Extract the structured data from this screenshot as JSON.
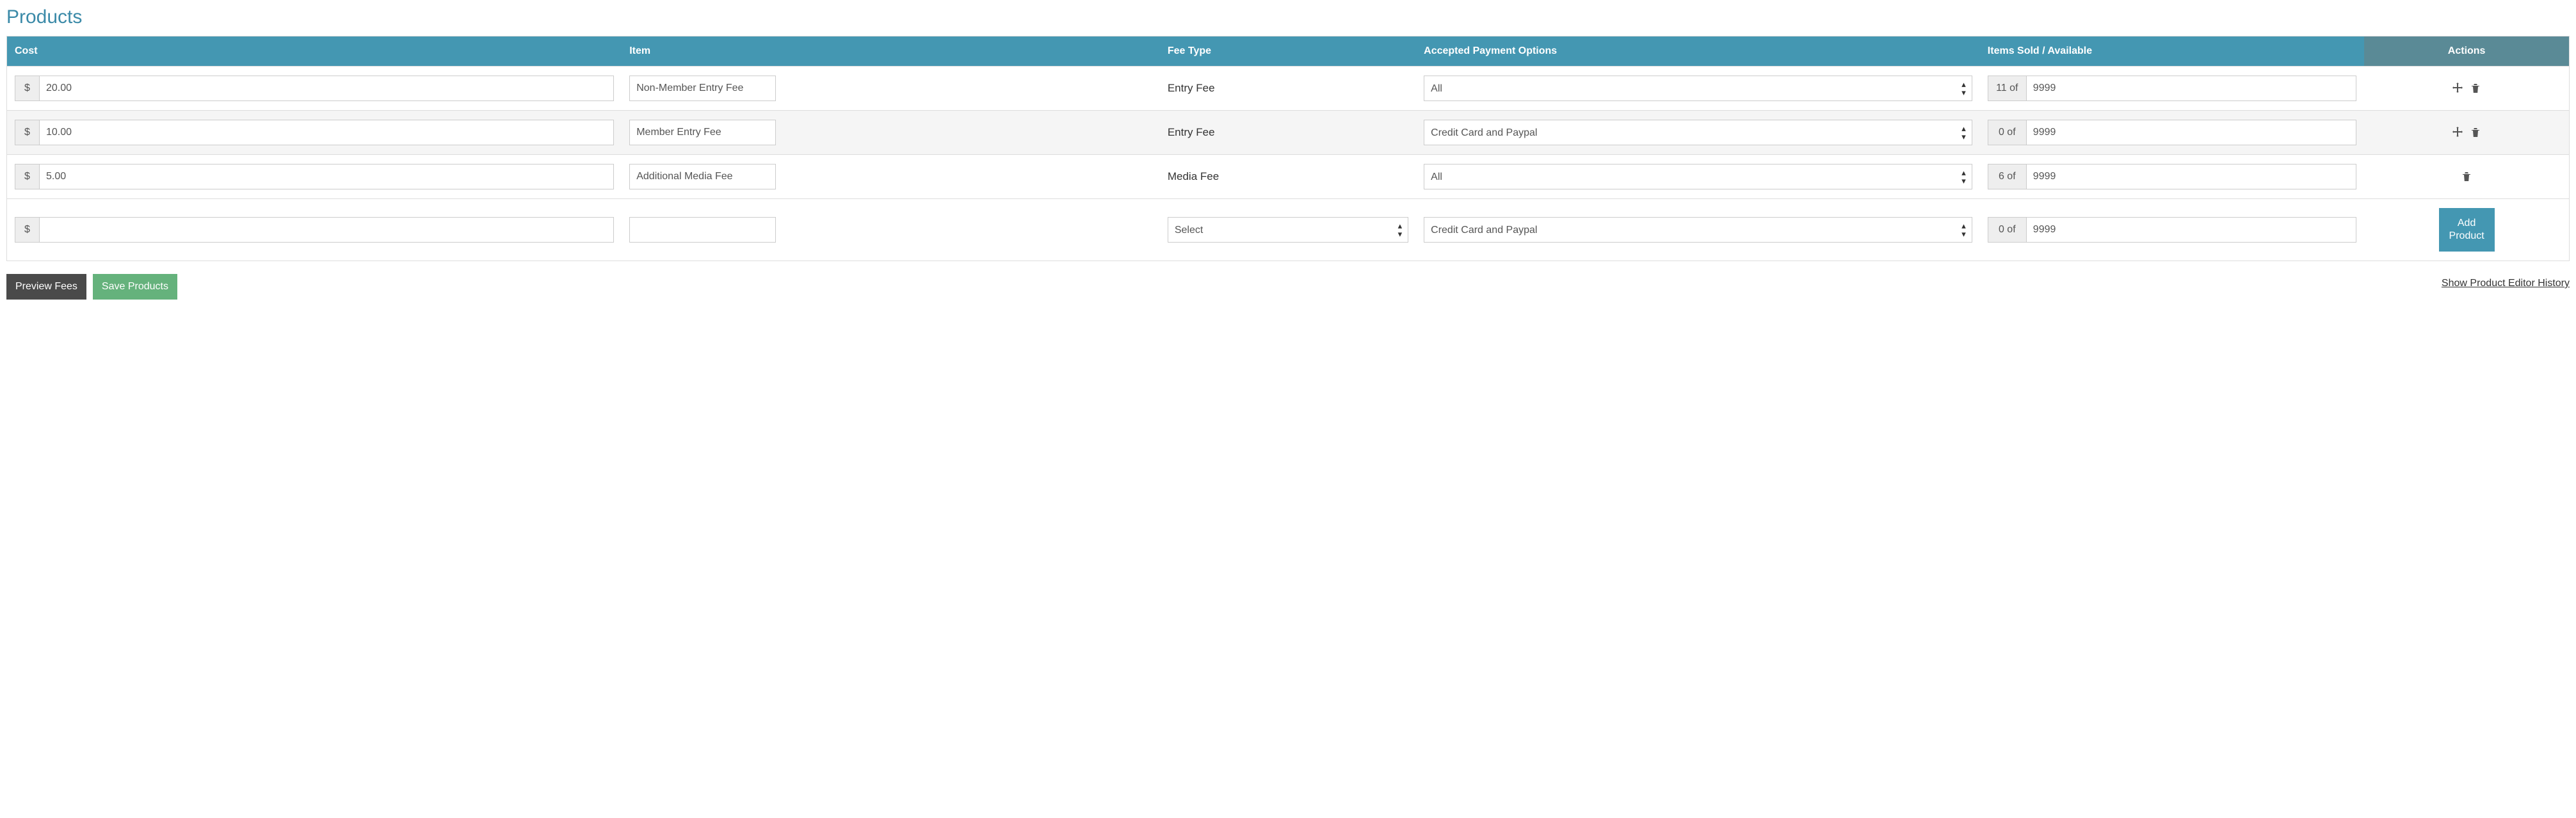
{
  "title": "Products",
  "columns": {
    "cost": "Cost",
    "item": "Item",
    "feetype": "Fee Type",
    "payment": "Accepted Payment Options",
    "sold": "Items Sold / Available",
    "actions": "Actions"
  },
  "currency_symbol": "$",
  "of_word": "of",
  "payment_options": [
    "All",
    "Credit Card and Paypal"
  ],
  "feetype_options": [
    "Select",
    "Entry Fee",
    "Media Fee"
  ],
  "rows": [
    {
      "cost": "20.00",
      "item": "Non-Member Entry Fee",
      "feetype_text": "Entry Fee",
      "feetype_is_select": false,
      "payment": "All",
      "sold": "11",
      "available": "9999",
      "show_move": true,
      "show_delete": true,
      "show_add": false,
      "alt": false
    },
    {
      "cost": "10.00",
      "item": "Member Entry Fee",
      "feetype_text": "Entry Fee",
      "feetype_is_select": false,
      "payment": "Credit Card and Paypal",
      "sold": "0",
      "available": "9999",
      "show_move": true,
      "show_delete": true,
      "show_add": false,
      "alt": true
    },
    {
      "cost": "5.00",
      "item": "Additional Media Fee",
      "feetype_text": "Media Fee",
      "feetype_is_select": false,
      "payment": "All",
      "sold": "6",
      "available": "9999",
      "show_move": false,
      "show_delete": true,
      "show_add": false,
      "alt": false
    },
    {
      "cost": "",
      "item": "",
      "feetype_text": "Select",
      "feetype_is_select": true,
      "payment": "Credit Card and Paypal",
      "sold": "0",
      "available": "9999",
      "show_move": false,
      "show_delete": false,
      "show_add": true,
      "alt": false
    }
  ],
  "buttons": {
    "add_product": "Add Product",
    "preview_fees": "Preview Fees",
    "save_products": "Save Products"
  },
  "links": {
    "history": "Show Product Editor History"
  }
}
